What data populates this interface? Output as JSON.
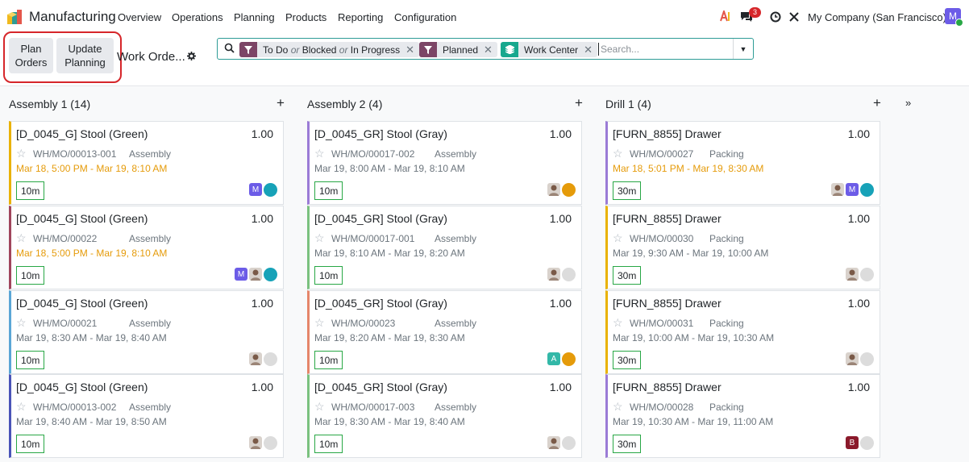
{
  "app": {
    "name": "Manufacturing"
  },
  "menu": [
    "Overview",
    "Operations",
    "Planning",
    "Products",
    "Reporting",
    "Configuration"
  ],
  "systray": {
    "message_count": "3",
    "company": "My Company (San Francisco)",
    "user_initial": "M"
  },
  "buttons": {
    "plan_orders": "Plan Orders",
    "update_planning": "Update Planning"
  },
  "breadcrumb": "Work Orde...",
  "search": {
    "facets": [
      {
        "parts": [
          "To Do",
          "or",
          "Blocked",
          "or",
          "In Progress"
        ],
        "icon": "filter-icon"
      },
      {
        "parts": [
          "Planned"
        ],
        "icon": "filter-icon"
      },
      {
        "parts": [
          "Work Center"
        ],
        "icon": "layers-icon"
      }
    ],
    "placeholder": "Search..."
  },
  "columns": [
    {
      "title": "Assembly 1 (14)",
      "cards": [
        {
          "title": "[D_0045_G] Stool (Green)",
          "qty": "1.00",
          "ref": "WH/MO/00013-001",
          "wc": "Assembly",
          "dates": "Mar 18, 5:00 PM  -  Mar 19, 8:10 AM",
          "late": true,
          "dur": "10m",
          "color": "#e9b200",
          "avatars": [
            "M"
          ],
          "status": "#17a2b8"
        },
        {
          "title": "[D_0045_G] Stool (Green)",
          "qty": "1.00",
          "ref": "WH/MO/00022",
          "wc": "Assembly",
          "dates": "Mar 18, 5:00 PM  -  Mar 19, 8:10 AM",
          "late": true,
          "dur": "10m",
          "color": "#a0455c",
          "avatars": [
            "M",
            "photo"
          ],
          "status": "#17a2b8"
        },
        {
          "title": "[D_0045_G] Stool (Green)",
          "qty": "1.00",
          "ref": "WH/MO/00021",
          "wc": "Assembly",
          "dates": "Mar 19, 8:30 AM  -  Mar 19, 8:40 AM",
          "late": false,
          "dur": "10m",
          "color": "#5aa6d6",
          "avatars": [
            "photo"
          ],
          "status": "#dcdcdc"
        },
        {
          "title": "[D_0045_G] Stool (Green)",
          "qty": "1.00",
          "ref": "WH/MO/00013-002",
          "wc": "Assembly",
          "dates": "Mar 19, 8:40 AM  -  Mar 19, 8:50 AM",
          "late": false,
          "dur": "10m",
          "color": "#4a54b8",
          "avatars": [
            "photo"
          ],
          "status": "#dcdcdc"
        }
      ]
    },
    {
      "title": "Assembly 2 (4)",
      "cards": [
        {
          "title": "[D_0045_GR] Stool (Gray)",
          "qty": "1.00",
          "ref": "WH/MO/00017-002",
          "wc": "Assembly",
          "dates": "Mar 19, 8:00 AM  -  Mar 19, 8:10 AM",
          "late": false,
          "dur": "10m",
          "color": "#9b7bd6",
          "avatars": [
            "photo"
          ],
          "status": "#e59b0a"
        },
        {
          "title": "[D_0045_GR] Stool (Gray)",
          "qty": "1.00",
          "ref": "WH/MO/00017-001",
          "wc": "Assembly",
          "dates": "Mar 19, 8:10 AM  -  Mar 19, 8:20 AM",
          "late": false,
          "dur": "10m",
          "color": "#7ac17e",
          "avatars": [
            "photo"
          ],
          "status": "#dcdcdc"
        },
        {
          "title": "[D_0045_GR] Stool (Gray)",
          "qty": "1.00",
          "ref": "WH/MO/00023",
          "wc": "Assembly",
          "dates": "Mar 19, 8:20 AM  -  Mar 19, 8:30 AM",
          "late": false,
          "dur": "10m",
          "color": "#e5866a",
          "avatars": [
            "A"
          ],
          "status": "#e59b0a"
        },
        {
          "title": "[D_0045_GR] Stool (Gray)",
          "qty": "1.00",
          "ref": "WH/MO/00017-003",
          "wc": "Assembly",
          "dates": "Mar 19, 8:30 AM  -  Mar 19, 8:40 AM",
          "late": false,
          "dur": "10m",
          "color": "#7ac17e",
          "avatars": [
            "photo"
          ],
          "status": "#dcdcdc"
        }
      ]
    },
    {
      "title": "Drill 1 (4)",
      "cards": [
        {
          "title": "[FURN_8855] Drawer",
          "qty": "1.00",
          "ref": "WH/MO/00027",
          "wc": "Packing",
          "dates": "Mar 18, 5:01 PM  -  Mar 19, 8:30 AM",
          "late": true,
          "dur": "30m",
          "color": "#9b7bd6",
          "avatars": [
            "photo",
            "M"
          ],
          "status": "#17a2b8"
        },
        {
          "title": "[FURN_8855] Drawer",
          "qty": "1.00",
          "ref": "WH/MO/00030",
          "wc": "Packing",
          "dates": "Mar 19, 9:30 AM  -  Mar 19, 10:00 AM",
          "late": false,
          "dur": "30m",
          "color": "#e9b200",
          "avatars": [
            "photo"
          ],
          "status": "#dcdcdc"
        },
        {
          "title": "[FURN_8855] Drawer",
          "qty": "1.00",
          "ref": "WH/MO/00031",
          "wc": "Packing",
          "dates": "Mar 19, 10:00 AM  -  Mar 19, 10:30 AM",
          "late": false,
          "dur": "30m",
          "color": "#e9b200",
          "avatars": [
            "photo"
          ],
          "status": "#dcdcdc"
        },
        {
          "title": "[FURN_8855] Drawer",
          "qty": "1.00",
          "ref": "WH/MO/00028",
          "wc": "Packing",
          "dates": "Mar 19, 10:30 AM  -  Mar 19, 11:00 AM",
          "late": false,
          "dur": "30m",
          "color": "#9b7bd6",
          "avatars": [
            "B"
          ],
          "status": "#dcdcdc"
        }
      ]
    }
  ],
  "colors": {
    "accent": "#2e9c96",
    "filter_facet": "#7c4566",
    "group_facet": "#17a88e",
    "highlight": "#d6262a"
  }
}
